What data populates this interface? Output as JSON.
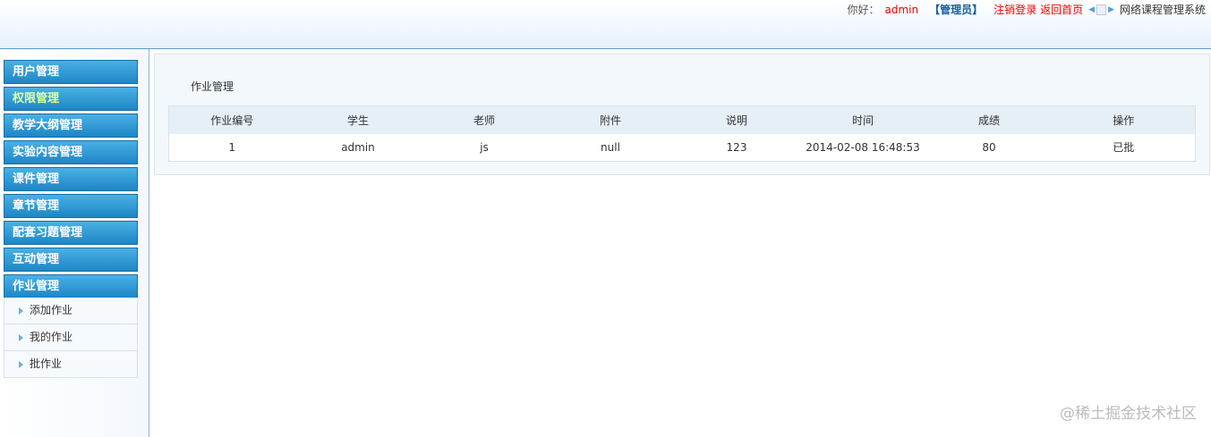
{
  "header": {
    "greeting": "你好：",
    "username": "admin",
    "role": "【管理员】",
    "logout": "注销登录",
    "home": "返回首页",
    "system_name": "网络课程管理系统"
  },
  "sidebar": {
    "menus": [
      "用户管理",
      "权限管理",
      "教学大纲管理",
      "实验内容管理",
      "课件管理",
      "章节管理",
      "配套习题管理",
      "互动管理",
      "作业管理"
    ],
    "subitems": [
      "添加作业",
      "我的作业",
      "批作业"
    ]
  },
  "main": {
    "title": "作业管理",
    "columns": [
      "作业编号",
      "学生",
      "老师",
      "附件",
      "说明",
      "时间",
      "成绩",
      "操作"
    ],
    "rows": [
      [
        "1",
        "admin",
        "js",
        "null",
        "123",
        "2014-02-08 16:48:53",
        "80",
        "已批"
      ]
    ]
  },
  "watermark": "@稀土掘金技术社区"
}
